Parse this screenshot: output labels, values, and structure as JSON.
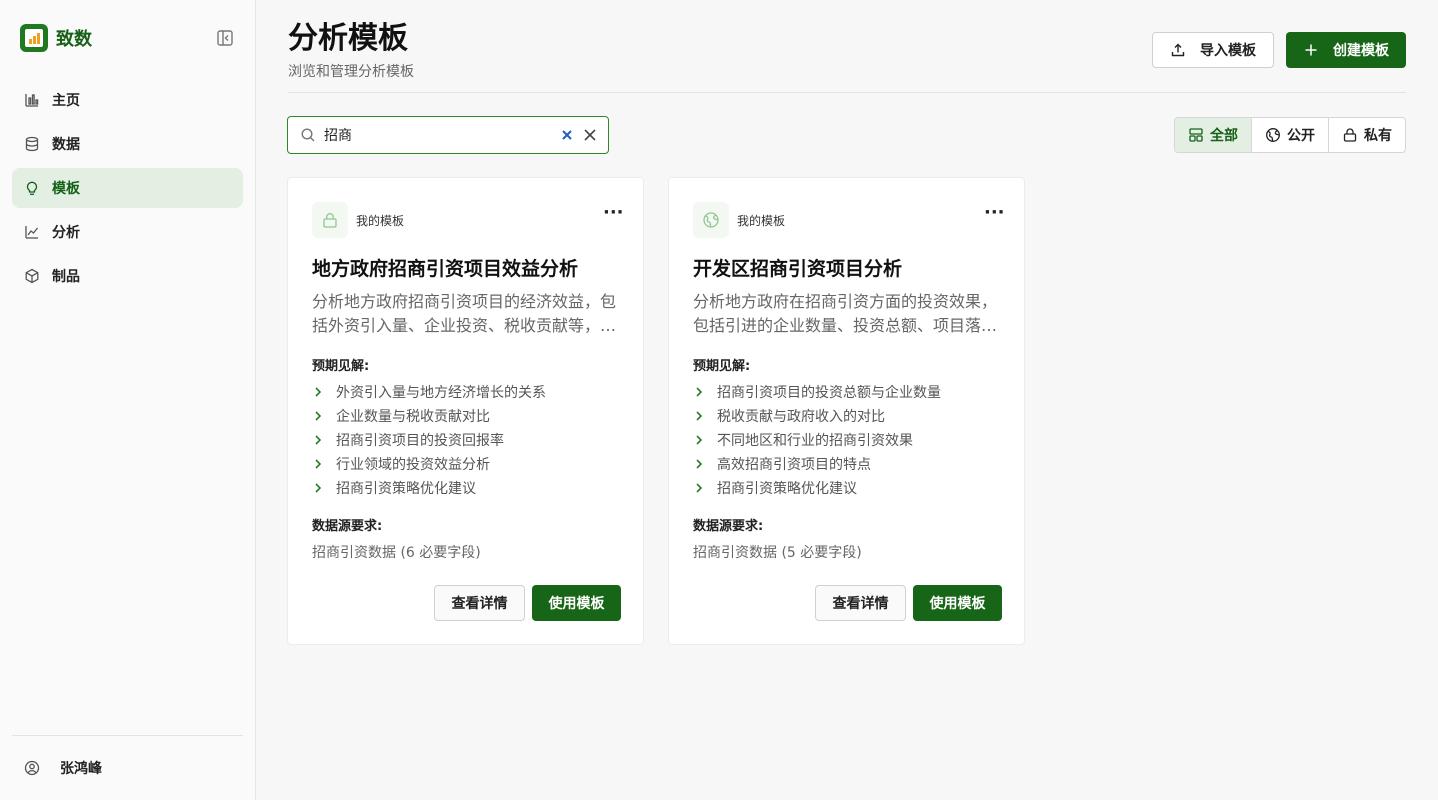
{
  "app": {
    "name": "致数"
  },
  "sidebar": {
    "items": [
      {
        "label": "主页",
        "icon": "bar-chart-icon"
      },
      {
        "label": "数据",
        "icon": "database-icon"
      },
      {
        "label": "模板",
        "icon": "lightbulb-icon",
        "active": true
      },
      {
        "label": "分析",
        "icon": "line-chart-icon"
      },
      {
        "label": "制品",
        "icon": "cube-icon"
      }
    ],
    "user": {
      "name": "张鸿峰"
    }
  },
  "header": {
    "title": "分析模板",
    "subtitle": "浏览和管理分析模板",
    "import_label": "导入模板",
    "create_label": "创建模板"
  },
  "search": {
    "value": "招商"
  },
  "filter": {
    "all": "全部",
    "public": "公开",
    "private": "私有",
    "selected": "全部"
  },
  "colors": {
    "accent": "#176617",
    "accent_light": "#e2efe2"
  },
  "cards": [
    {
      "owner": "我的模板",
      "title": "地方政府招商引资项目效益分析",
      "description": "分析地方政府招商引资项目的经济效益，包括外资引入量、企业投资、税收贡献等，评估招商引资项目的投资回报率和整体效益。",
      "insights_label": "预期见解:",
      "insights": [
        "外资引入量与地方经济增长的关系",
        "企业数量与税收贡献对比",
        "招商引资项目的投资回报率",
        "行业领域的投资效益分析",
        "招商引资策略优化建议"
      ],
      "source_label": "数据源要求:",
      "source": "招商引资数据 (6 必要字段)",
      "detail_label": "查看详情",
      "use_label": "使用模板"
    },
    {
      "owner": "我的模板",
      "title": "开发区招商引资项目分析",
      "description": "分析地方政府在招商引资方面的投资效果，包括引进的企业数量、投资总额、项目落地情况等，评估不同地区和行业的招商引资效果。",
      "insights_label": "预期见解:",
      "insights": [
        "招商引资项目的投资总额与企业数量",
        "税收贡献与政府收入的对比",
        "不同地区和行业的招商引资效果",
        "高效招商引资项目的特点",
        "招商引资策略优化建议"
      ],
      "source_label": "数据源要求:",
      "source": "招商引资数据 (5 必要字段)",
      "detail_label": "查看详情",
      "use_label": "使用模板"
    }
  ]
}
